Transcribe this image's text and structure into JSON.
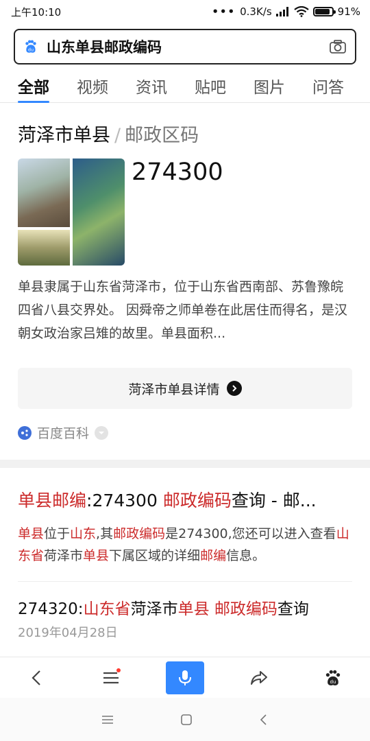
{
  "status_bar": {
    "time": "上午10:10",
    "dots": "•••",
    "speed": "0.3K/s",
    "battery": "91%",
    "battery_level": 0.91
  },
  "search": {
    "query": "山东单县邮政编码"
  },
  "tabs": [
    {
      "label": "全部",
      "active": true
    },
    {
      "label": "视频"
    },
    {
      "label": "资讯"
    },
    {
      "label": "贴吧"
    },
    {
      "label": "图片"
    },
    {
      "label": "问答"
    }
  ],
  "card1": {
    "title": "菏泽市单县",
    "separator": "/",
    "subtitle": "邮政区码",
    "postcode": "274300",
    "description": "单县隶属于山东省菏泽市，位于山东省西南部、苏鲁豫皖四省八县交界处。 因舜帝之师单卷在此居住而得名，是汉朝女政治家吕雉的故里。单县面积...",
    "detail_button": "菏泽市单县详情",
    "source": "百度百科"
  },
  "result1": {
    "title_parts": [
      {
        "text": "单县邮编",
        "hl": true
      },
      {
        "text": ":274300 ",
        "hl": false
      },
      {
        "text": "邮政编码",
        "hl": true
      },
      {
        "text": "查询 - 邮...",
        "hl": false
      }
    ],
    "snippet_parts": [
      {
        "text": "单县",
        "hl": true
      },
      {
        "text": "位于",
        "hl": false
      },
      {
        "text": "山东",
        "hl": true
      },
      {
        "text": ",其",
        "hl": false
      },
      {
        "text": "邮政编码",
        "hl": true
      },
      {
        "text": "是274300,您还可以进入查看",
        "hl": false
      },
      {
        "text": "山东省",
        "hl": true
      },
      {
        "text": "荷泽市",
        "hl": false
      },
      {
        "text": "单县",
        "hl": true
      },
      {
        "text": "下属区域的详细",
        "hl": false
      },
      {
        "text": "邮编",
        "hl": true
      },
      {
        "text": "信息。",
        "hl": false
      }
    ]
  },
  "result2": {
    "title_parts": [
      {
        "text": "274320:",
        "hl": false
      },
      {
        "text": "山东省",
        "hl": true
      },
      {
        "text": "菏泽市",
        "hl": false
      },
      {
        "text": "单县",
        "hl": true
      },
      {
        "text": " ",
        "hl": false
      },
      {
        "text": "邮政编码",
        "hl": true
      },
      {
        "text": "查询",
        "hl": false
      }
    ],
    "date": "2019年04月28日"
  },
  "toolbar": {
    "icons": [
      "back-icon",
      "menu-icon",
      "microphone-icon",
      "share-icon",
      "baidu-paw-icon"
    ]
  },
  "navbar": {
    "icons": [
      "nav-menu-icon",
      "nav-home-icon",
      "nav-back-icon"
    ]
  },
  "colors": {
    "accent": "#3388ff",
    "highlight": "#cc2b2b"
  }
}
